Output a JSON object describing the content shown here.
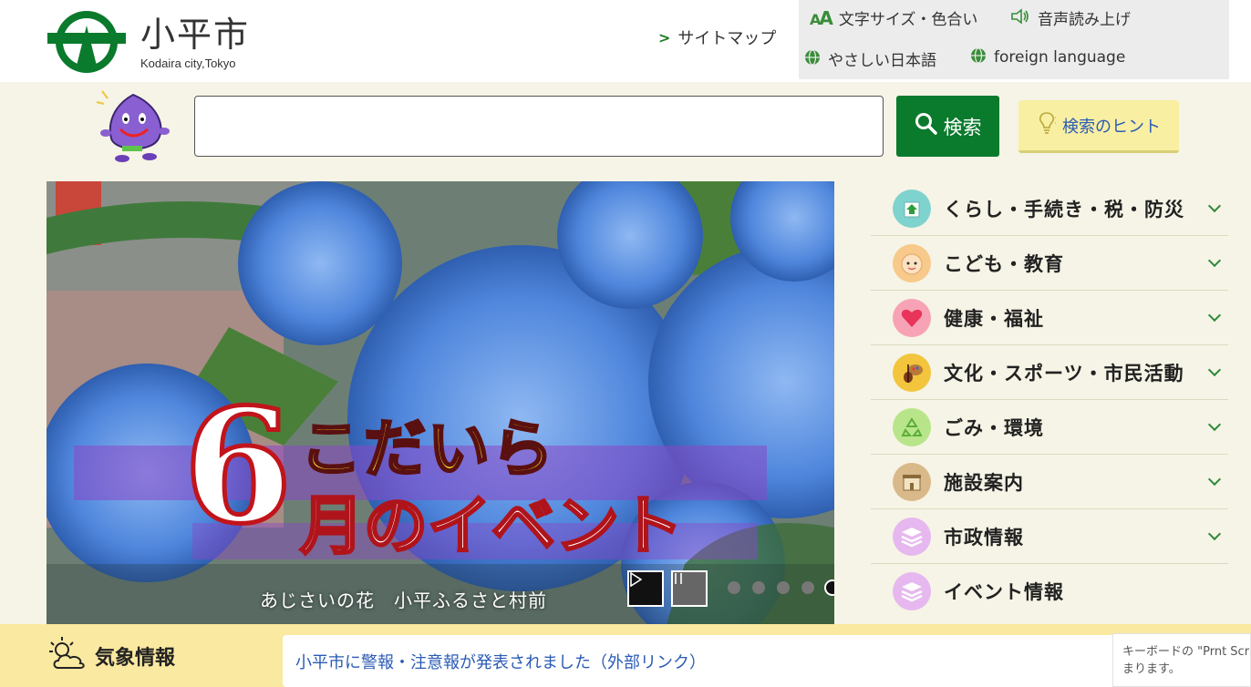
{
  "header": {
    "city_name": "小平市",
    "city_sub": "Kodaira city,Tokyo",
    "sitemap_label": "サイトマップ",
    "utility": {
      "font_color_label": "文字サイズ・色合い",
      "voice_label": "音声読み上げ",
      "easy_japanese_label": "やさしい日本語",
      "foreign_label": "foreign language"
    }
  },
  "search": {
    "value": "",
    "button_label": "検索",
    "hint_label": "検索のヒント"
  },
  "hero": {
    "title_line1": "こだいら",
    "title_number": "6",
    "title_line2": "月のイベント",
    "caption": "あじさいの花　小平ふるさと村前",
    "play_icon": "play-icon",
    "pause_icon": "pause-icon",
    "dots_total": 5,
    "dot_active": 5
  },
  "menu": {
    "items": [
      {
        "label": "くらし・手続き・税・防災",
        "icon": "house-icon",
        "color": "#7fd3cf",
        "has_submenu": true
      },
      {
        "label": "こども・教育",
        "icon": "child-face-icon",
        "color": "#f7c98a",
        "has_submenu": true
      },
      {
        "label": "健康・福祉",
        "icon": "heart-icon",
        "color": "#f7a3b5",
        "has_submenu": true
      },
      {
        "label": "文化・スポーツ・市民活動",
        "icon": "violin-palette-icon",
        "color": "#f2c53d",
        "has_submenu": true
      },
      {
        "label": "ごみ・環境",
        "icon": "recycle-icon",
        "color": "#b9e58a",
        "has_submenu": true
      },
      {
        "label": "施設案内",
        "icon": "building-icon",
        "color": "#d9b98a",
        "has_submenu": true
      },
      {
        "label": "市政情報",
        "icon": "layers-icon",
        "color": "#e6b8ef",
        "has_submenu": true
      },
      {
        "label": "イベント情報",
        "icon": "layers-icon",
        "color": "#e6b8ef",
        "has_submenu": false
      }
    ]
  },
  "weather": {
    "title": "気象情報",
    "link_text": "小平市に警報・注意報が発表されました（外部リンク）"
  },
  "toast": {
    "line1": "キーボードの \"Prnt Scrn\"",
    "line2": "まります。"
  },
  "colors": {
    "brand_green": "#0a7a2c",
    "page_bg": "#f6f4e6",
    "weather_bg": "#fae9a0",
    "link_blue": "#2a5bb5"
  }
}
